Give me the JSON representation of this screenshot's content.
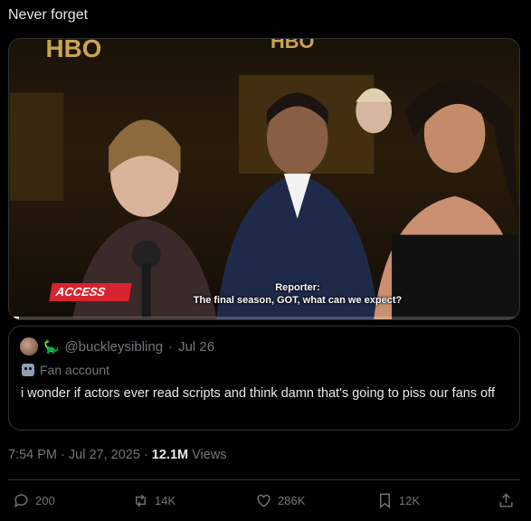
{
  "post": {
    "text": "Never forget"
  },
  "video": {
    "logo": "ACCESS",
    "caption_line1": "Reporter:",
    "caption_line2": "The final season, GOT, what can we expect?",
    "progress": 0.02
  },
  "quoted": {
    "handle": "@buckleysibling",
    "date": "Jul 26",
    "account_type": "Fan account",
    "text": "i wonder if actors ever read scripts and think damn that's going to piss our fans off"
  },
  "meta": {
    "time_date": "7:54 PM · Jul 27, 2025 · ",
    "views_count": "12.1M",
    "views_label": " Views"
  },
  "actions": {
    "replies": "200",
    "reposts": "14K",
    "likes": "286K",
    "bookmarks": "12K"
  },
  "icons": [
    "reply-icon",
    "repost-icon",
    "like-icon",
    "bookmark-icon",
    "share-icon"
  ]
}
